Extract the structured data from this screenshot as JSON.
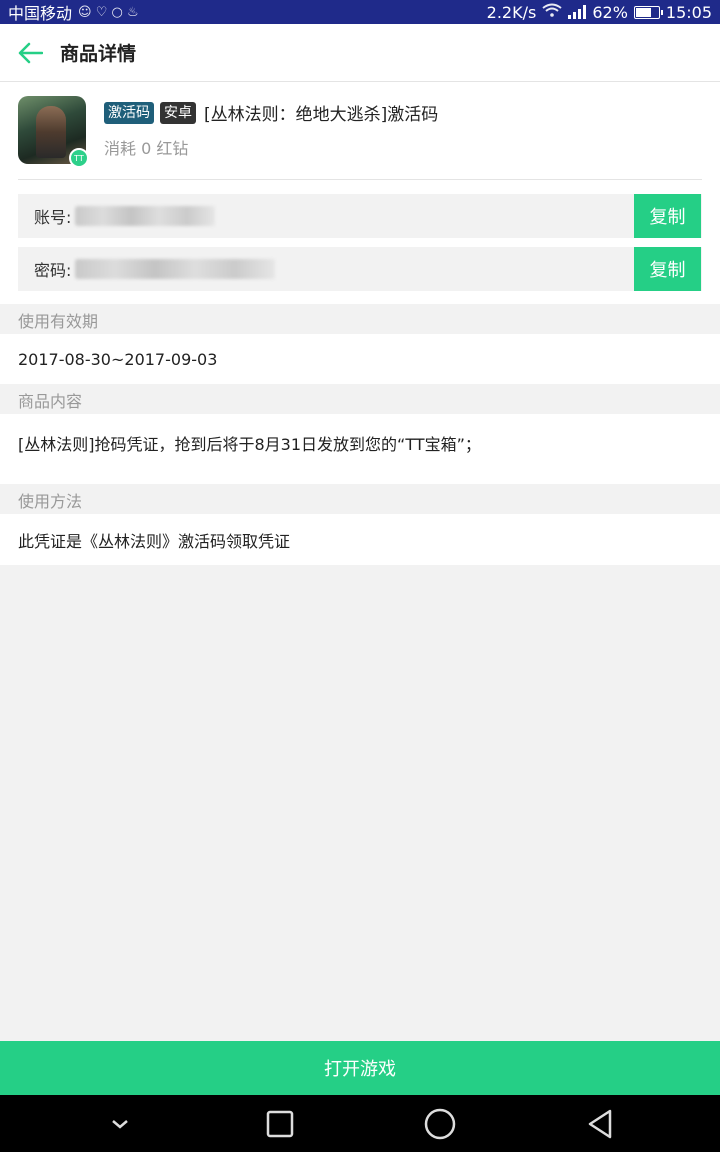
{
  "status_bar": {
    "carrier": "中国移动",
    "speed": "2.2K/s",
    "battery": "62%",
    "battery_level": 0.62,
    "time": "15:05"
  },
  "header": {
    "title": "商品详情"
  },
  "product": {
    "tags": [
      "激活码",
      "安卓"
    ],
    "name": "[丛林法则：绝地大逃杀]激活码",
    "cost": "消耗 0 红钻",
    "icon_badge": "TT"
  },
  "credentials": {
    "account_label": "账号:",
    "password_label": "密码:",
    "copy_label": "复制"
  },
  "sections": {
    "validity": {
      "title": "使用有效期",
      "content": "2017-08-30~2017-09-03"
    },
    "content": {
      "title": "商品内容",
      "content": "[丛林法则]抢码凭证，抢到后将于8月31日发放到您的“TT宝箱”；"
    },
    "usage": {
      "title": "使用方法",
      "content": "此凭证是《丛林法则》激活码领取凭证"
    }
  },
  "footer": {
    "open_game_label": "打开游戏"
  },
  "colors": {
    "accent": "#25cf86",
    "status_bar": "#1f2a8a"
  }
}
